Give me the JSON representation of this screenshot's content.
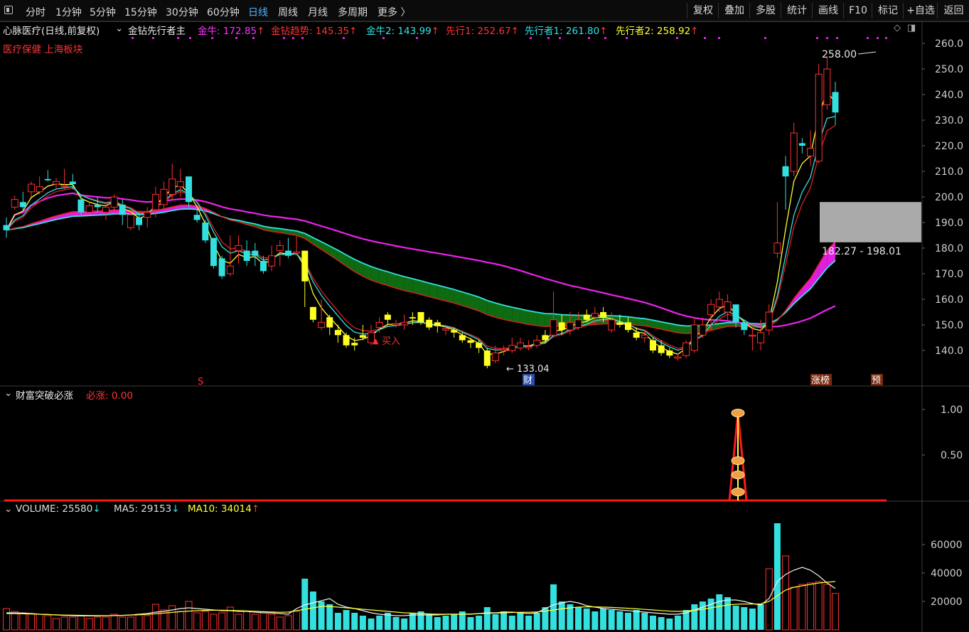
{
  "toolbar": {
    "left": [
      {
        "label": "分时",
        "x": 36
      },
      {
        "label": "1分钟",
        "x": 78
      },
      {
        "label": "5分钟",
        "x": 126
      },
      {
        "label": "15分钟",
        "x": 175
      },
      {
        "label": "30分钟",
        "x": 233
      },
      {
        "label": "60分钟",
        "x": 291
      },
      {
        "label": "日线",
        "x": 349,
        "active": true
      },
      {
        "label": "周线",
        "x": 391
      },
      {
        "label": "月线",
        "x": 433
      },
      {
        "label": "多周期",
        "x": 475
      },
      {
        "label": "更多 〉",
        "x": 531
      }
    ],
    "right": [
      {
        "label": "复权",
        "x": 966,
        "w": 44
      },
      {
        "label": "叠加",
        "x": 1010,
        "w": 44
      },
      {
        "label": "多股",
        "x": 1054,
        "w": 44
      },
      {
        "label": "统计",
        "x": 1098,
        "w": 44
      },
      {
        "label": "画线",
        "x": 1142,
        "w": 44
      },
      {
        "label": "F10",
        "x": 1186,
        "w": 40
      },
      {
        "label": "标记",
        "x": 1226,
        "w": 44
      },
      {
        "label": "+自选",
        "x": 1270,
        "w": 48
      },
      {
        "label": "返回",
        "x": 1318,
        "w": 45
      }
    ]
  },
  "main_panel": {
    "stock_title": "心脉医疗(日线,前复权)",
    "indicator_name": "金钻先行者主",
    "indicators": [
      {
        "label": "金牛",
        "value": "172.85",
        "color": "#ff33ff",
        "arrow": "↑"
      },
      {
        "label": "金钻趋势",
        "value": "145.35",
        "color": "#ff3333",
        "arrow": "↑"
      },
      {
        "label": "金牛2",
        "value": "143.99",
        "color": "#33e0e0",
        "arrow": "↑"
      },
      {
        "label": "先行1",
        "value": "252.67",
        "color": "#ff3333",
        "arrow": "↑"
      },
      {
        "label": "先行者1",
        "value": "261.80",
        "color": "#33e0e0",
        "arrow": "↑"
      },
      {
        "label": "先行者2",
        "value": "258.92",
        "color": "#ffff33",
        "arrow": "↑"
      }
    ],
    "sector_tags": "医疗保健 上海板块",
    "high_label": "258.00",
    "low_label": "133.04",
    "range_label": "182.27 - 198.01",
    "buy_label": "买入",
    "s_marker": "S",
    "fin_marker": "财",
    "zt_marker": "涨榜",
    "yu_marker": "预",
    "y_ticks": [
      "260.0",
      "250.0",
      "240.0",
      "230.0",
      "220.0",
      "210.0",
      "200.0",
      "190.0",
      "180.0",
      "170.0",
      "160.0",
      "150.0",
      "140.0"
    ]
  },
  "sub_panel": {
    "name": "财富突破必涨",
    "value_label": "必涨",
    "value": "0.00",
    "y_ticks": [
      "1.00",
      "0.50"
    ]
  },
  "volume_panel": {
    "labels": [
      {
        "label": "VOLUME",
        "value": "25580",
        "arrow": "↓",
        "color": "#dddddd",
        "arrow_color": "#33e0e0"
      },
      {
        "label": "MA5",
        "value": "29153",
        "arrow": "↓",
        "color": "#dddddd",
        "arrow_color": "#33e0e0"
      },
      {
        "label": "MA10",
        "value": "34014",
        "arrow": "↑",
        "color": "#ffff33",
        "arrow_color": "#ff3333"
      }
    ],
    "y_ticks": [
      "60000",
      "40000",
      "20000"
    ]
  },
  "chart_data": {
    "type": "candlestick",
    "price_range": [
      130,
      262
    ],
    "candles": [
      [
        189.0,
        187.0,
        192.0,
        184.0
      ],
      [
        196.0,
        199.0,
        200.5,
        195.0
      ],
      [
        198.0,
        196.0,
        202.0,
        194.5
      ],
      [
        202.0,
        205.0,
        206.0,
        200.0
      ],
      [
        202.0,
        204.0,
        208.0,
        201.0
      ],
      [
        207.0,
        206.5,
        210.5,
        206.0
      ],
      [
        205.0,
        206.0,
        207.5,
        203.0
      ],
      [
        204.0,
        204.5,
        211.0,
        203.0
      ],
      [
        206.0,
        205.0,
        209.0,
        203.0
      ],
      [
        199.0,
        194.0,
        201.0,
        193.0
      ],
      [
        194.0,
        196.5,
        198.0,
        193.0
      ],
      [
        197.0,
        196.0,
        200.0,
        194.0
      ],
      [
        194.0,
        196.0,
        198.0,
        191.0
      ],
      [
        196.0,
        200.0,
        201.0,
        194.0
      ],
      [
        197.0,
        193.0,
        199.0,
        189.0
      ],
      [
        188.0,
        193.0,
        195.0,
        187.0
      ],
      [
        192.0,
        189.0,
        194.0,
        187.0
      ],
      [
        192.0,
        194.0,
        196.0,
        188.0
      ],
      [
        195.0,
        201.0,
        204.0,
        192.0
      ],
      [
        197.0,
        203.0,
        206.0,
        195.0
      ],
      [
        201.0,
        207.0,
        213.0,
        199.0
      ],
      [
        204.0,
        206.0,
        211.0,
        200.0
      ],
      [
        208.0,
        198.0,
        208.0,
        196.0
      ],
      [
        193.0,
        191.0,
        195.0,
        190.0
      ],
      [
        190.0,
        183.0,
        191.0,
        182.0
      ],
      [
        184.0,
        173.0,
        184.0,
        172.0
      ],
      [
        176.0,
        169.0,
        177.0,
        168.0
      ],
      [
        170.0,
        173.0,
        185.0,
        169.0
      ],
      [
        179.0,
        181.0,
        185.0,
        174.0
      ],
      [
        179.0,
        175.0,
        183.0,
        173.0
      ],
      [
        179.0,
        177.0,
        182.0,
        173.0
      ],
      [
        175.0,
        171.0,
        177.0,
        170.0
      ],
      [
        173.0,
        177.0,
        181.0,
        171.0
      ],
      [
        179.0,
        181.0,
        183.0,
        173.0
      ],
      [
        179.0,
        177.0,
        184.0,
        176.0
      ],
      [
        178.0,
        178.5,
        185.0,
        177.0
      ],
      [
        179.0,
        167.0,
        179.0,
        157.0
      ],
      [
        157.0,
        152.0,
        157.0,
        151.0
      ],
      [
        149.0,
        151.0,
        160.0,
        148.0
      ],
      [
        153.0,
        149.0,
        154.0,
        146.0
      ],
      [
        148.0,
        146.0,
        150.0,
        143.0
      ],
      [
        146.0,
        142.0,
        147.0,
        141.0
      ],
      [
        143.0,
        142.0,
        145.0,
        140.0
      ],
      [
        146.0,
        145.0,
        150.0,
        144.0
      ],
      [
        143.0,
        147.0,
        150.0,
        142.0
      ],
      [
        149.0,
        151.0,
        153.0,
        147.0
      ],
      [
        154.0,
        152.0,
        155.0,
        150.0
      ],
      [
        150.0,
        150.5,
        152.0,
        149.0
      ],
      [
        150.0,
        151.0,
        154.0,
        148.0
      ],
      [
        153.0,
        152.5,
        155.0,
        150.0
      ],
      [
        155.0,
        151.0,
        155.0,
        150.0
      ],
      [
        152.0,
        149.0,
        153.0,
        148.0
      ],
      [
        151.0,
        149.5,
        152.0,
        147.0
      ],
      [
        148.0,
        148.5,
        150.0,
        146.0
      ],
      [
        148.0,
        147.0,
        149.0,
        145.0
      ],
      [
        146.0,
        144.0,
        147.0,
        143.0
      ],
      [
        144.0,
        143.0,
        145.0,
        141.0
      ],
      [
        143.0,
        141.0,
        144.0,
        139.0
      ],
      [
        140.0,
        134.0,
        141.0,
        133.04
      ],
      [
        136.0,
        139.0,
        142.0,
        135.0
      ],
      [
        140.0,
        140.5,
        142.0,
        138.0
      ],
      [
        140.0,
        142.0,
        145.0,
        139.0
      ],
      [
        141.0,
        143.0,
        145.0,
        140.0
      ],
      [
        141.0,
        141.5,
        144.0,
        140.0
      ],
      [
        142.0,
        144.0,
        146.0,
        141.0
      ],
      [
        146.0,
        144.0,
        148.0,
        143.0
      ],
      [
        146.0,
        152.0,
        163.0,
        145.0
      ],
      [
        151.0,
        148.0,
        154.0,
        146.0
      ],
      [
        148.0,
        151.0,
        155.0,
        146.0
      ],
      [
        149.0,
        152.0,
        155.0,
        148.0
      ],
      [
        154.0,
        152.0,
        156.0,
        151.0
      ],
      [
        153.0,
        154.5,
        157.0,
        150.0
      ],
      [
        155.0,
        153.0,
        157.0,
        151.0
      ],
      [
        148.0,
        152.0,
        155.0,
        147.0
      ],
      [
        151.0,
        150.0,
        154.0,
        149.0
      ],
      [
        151.0,
        148.0,
        153.0,
        147.0
      ],
      [
        147.0,
        145.0,
        149.0,
        144.0
      ],
      [
        145.0,
        146.0,
        148.0,
        143.0
      ],
      [
        144.0,
        140.0,
        145.0,
        139.0
      ],
      [
        142.0,
        139.0,
        144.0,
        138.0
      ],
      [
        140.0,
        138.0,
        141.0,
        137.0
      ],
      [
        137.0,
        137.5,
        139.0,
        136.0
      ],
      [
        138.0,
        143.0,
        144.0,
        137.0
      ],
      [
        140.0,
        150.0,
        153.0,
        139.0
      ],
      [
        146.0,
        150.0,
        153.0,
        145.0
      ],
      [
        154.0,
        158.0,
        160.0,
        148.0
      ],
      [
        157.0,
        160.0,
        163.0,
        155.0
      ],
      [
        155.0,
        159.0,
        162.0,
        152.0
      ],
      [
        158.0,
        151.0,
        158.0,
        149.0
      ],
      [
        151.0,
        148.0,
        152.0,
        146.0
      ],
      [
        146.0,
        146.0,
        149.0,
        140.0
      ],
      [
        143.0,
        147.0,
        152.0,
        140.0
      ],
      [
        148.0,
        155.0,
        158.0,
        146.0
      ],
      [
        178.0,
        182.0,
        198.0,
        176.0
      ],
      [
        212.0,
        208.0,
        216.0,
        195.0
      ],
      [
        210.0,
        225.0,
        229.0,
        208.0
      ],
      [
        221.0,
        220.0,
        223.0,
        217.0
      ],
      [
        216.0,
        219.0,
        226.0,
        212.0
      ],
      [
        214.0,
        248.0,
        252.0,
        213.0
      ],
      [
        236.0,
        250.0,
        255.0,
        234.0
      ],
      [
        241.0,
        233.0,
        245.0,
        228.0
      ]
    ],
    "volume_range": [
      0,
      80000
    ],
    "volumes": [
      [
        15000,
        "u"
      ],
      [
        13000,
        "u"
      ],
      [
        12000,
        "u"
      ],
      [
        11500,
        "u"
      ],
      [
        11000,
        "u"
      ],
      [
        10000,
        "u"
      ],
      [
        8000,
        "u"
      ],
      [
        9000,
        "u"
      ],
      [
        9000,
        "u"
      ],
      [
        10000,
        "u"
      ],
      [
        8000,
        "u"
      ],
      [
        9000,
        "u"
      ],
      [
        9000,
        "u"
      ],
      [
        11000,
        "u"
      ],
      [
        9000,
        "u"
      ],
      [
        9000,
        "u"
      ],
      [
        11000,
        "u"
      ],
      [
        10000,
        "u"
      ],
      [
        18000,
        "u"
      ],
      [
        14000,
        "u"
      ],
      [
        17000,
        "u"
      ],
      [
        13000,
        "u"
      ],
      [
        20000,
        "u"
      ],
      [
        12000,
        "u"
      ],
      [
        13000,
        "u"
      ],
      [
        11000,
        "u"
      ],
      [
        12000,
        "u"
      ],
      [
        16000,
        "u"
      ],
      [
        11000,
        "u"
      ],
      [
        13000,
        "u"
      ],
      [
        11000,
        "u"
      ],
      [
        12000,
        "u"
      ],
      [
        11000,
        "u"
      ],
      [
        9000,
        "u"
      ],
      [
        10000,
        "u"
      ],
      [
        13000,
        "u"
      ],
      [
        36000,
        "d"
      ],
      [
        27000,
        "d"
      ],
      [
        20000,
        "d"
      ],
      [
        18000,
        "d"
      ],
      [
        12000,
        "d"
      ],
      [
        14000,
        "d"
      ],
      [
        12000,
        "d"
      ],
      [
        10000,
        "d"
      ],
      [
        8000,
        "d"
      ],
      [
        10000,
        "d"
      ],
      [
        12000,
        "d"
      ],
      [
        9000,
        "d"
      ],
      [
        8000,
        "d"
      ],
      [
        12000,
        "d"
      ],
      [
        13000,
        "d"
      ],
      [
        11000,
        "d"
      ],
      [
        9000,
        "d"
      ],
      [
        10000,
        "d"
      ],
      [
        11000,
        "d"
      ],
      [
        13000,
        "d"
      ],
      [
        9000,
        "d"
      ],
      [
        10000,
        "d"
      ],
      [
        16000,
        "d"
      ],
      [
        11000,
        "d"
      ],
      [
        13000,
        "d"
      ],
      [
        10000,
        "d"
      ],
      [
        12000,
        "d"
      ],
      [
        10000,
        "d"
      ],
      [
        12000,
        "d"
      ],
      [
        16000,
        "d"
      ],
      [
        32000,
        "d"
      ],
      [
        20000,
        "d"
      ],
      [
        18000,
        "d"
      ],
      [
        16000,
        "d"
      ],
      [
        15000,
        "d"
      ],
      [
        13000,
        "d"
      ],
      [
        15000,
        "d"
      ],
      [
        14000,
        "d"
      ],
      [
        13000,
        "d"
      ],
      [
        12000,
        "d"
      ],
      [
        14000,
        "d"
      ],
      [
        12000,
        "d"
      ],
      [
        10000,
        "d"
      ],
      [
        9000,
        "d"
      ],
      [
        8000,
        "d"
      ],
      [
        10000,
        "d"
      ],
      [
        14000,
        "d"
      ],
      [
        18000,
        "d"
      ],
      [
        20000,
        "d"
      ],
      [
        22000,
        "d"
      ],
      [
        25000,
        "d"
      ],
      [
        23000,
        "d"
      ],
      [
        17000,
        "d"
      ],
      [
        16000,
        "d"
      ],
      [
        15000,
        "d"
      ],
      [
        18000,
        "d"
      ],
      [
        43000,
        "u"
      ],
      [
        75000,
        "d"
      ],
      [
        52000,
        "u"
      ],
      [
        30000,
        "u"
      ],
      [
        32000,
        "u"
      ],
      [
        33000,
        "u"
      ],
      [
        34000,
        "u"
      ],
      [
        32000,
        "u"
      ],
      [
        25580,
        "u"
      ]
    ],
    "vol_ma5": [
      12000,
      12000,
      11800,
      11500,
      11000,
      10800,
      10500,
      10200,
      10000,
      9800,
      9800,
      9800,
      9900,
      10000,
      10200,
      10500,
      11000,
      11500,
      12500,
      13000,
      14000,
      15000,
      15500,
      15000,
      14500,
      14000,
      13500,
      13500,
      13000,
      13000,
      12500,
      12000,
      12000,
      11500,
      11000,
      15000,
      17500,
      19000,
      20500,
      22000,
      18000,
      16000,
      15000,
      13500,
      12000,
      11000,
      10500,
      10000,
      10000,
      10500,
      10500,
      10500,
      10500,
      11000,
      11000,
      11000,
      11000,
      11500,
      12000,
      12000,
      12500,
      12500,
      12000,
      11500,
      12000,
      15000,
      17500,
      19000,
      20000,
      19000,
      17000,
      16000,
      15000,
      14500,
      14000,
      13500,
      13000,
      12500,
      12000,
      11500,
      11000,
      11000,
      12000,
      14000,
      16000,
      18000,
      20000,
      21000,
      21000,
      20000,
      18500,
      17500,
      22000,
      34000,
      39000,
      42000,
      44000,
      42000,
      38000,
      33000,
      29153
    ],
    "vol_ma10": [
      11500,
      11400,
      11300,
      11200,
      11000,
      10800,
      10600,
      10400,
      10300,
      10200,
      10100,
      10000,
      10000,
      10100,
      10200,
      10400,
      10600,
      10900,
      11300,
      11800,
      12300,
      12800,
      13200,
      13500,
      13700,
      13800,
      13800,
      13700,
      13500,
      13300,
      13000,
      12800,
      12600,
      12400,
      12500,
      13500,
      14500,
      15500,
      16500,
      16500,
      16000,
      15500,
      15000,
      14500,
      14000,
      13500,
      13000,
      12500,
      12000,
      11800,
      11500,
      11200,
      11000,
      11000,
      11000,
      11000,
      11200,
      11400,
      11600,
      11800,
      12000,
      12200,
      12400,
      12400,
      12600,
      13200,
      14000,
      14800,
      15500,
      16000,
      16200,
      16200,
      16000,
      15800,
      15500,
      15200,
      14800,
      14400,
      14000,
      13600,
      13200,
      13000,
      13200,
      13800,
      14500,
      15500,
      16500,
      17500,
      18000,
      18200,
      18200,
      18200,
      20000,
      24000,
      28000,
      30000,
      31000,
      32000,
      33000,
      33500,
      34014
    ]
  }
}
